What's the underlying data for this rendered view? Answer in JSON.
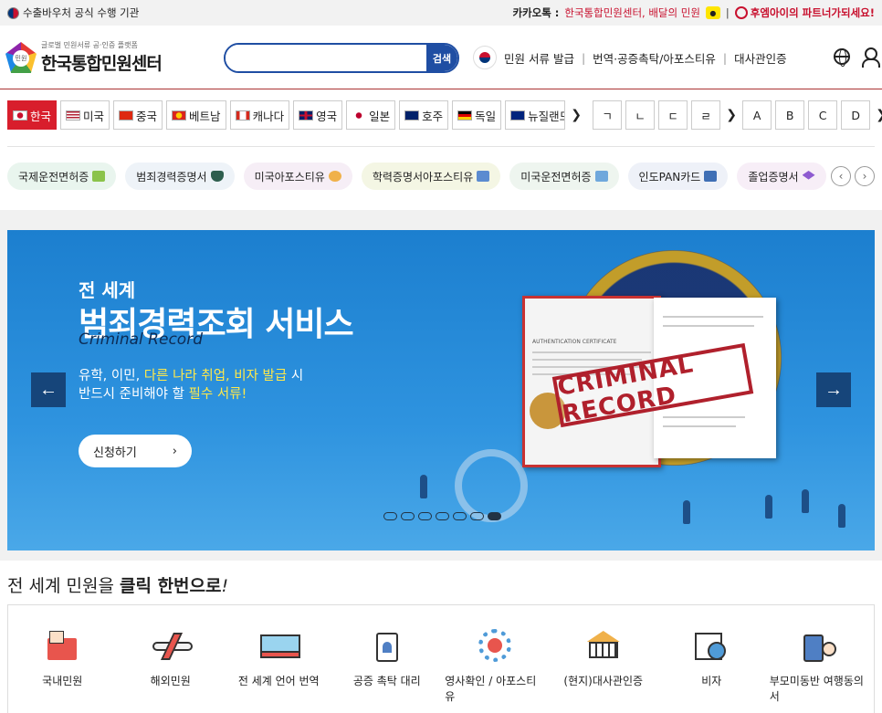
{
  "topbar": {
    "left_text": "수출바우처 공식 수행 기관",
    "kakao_label": "카카오톡 :",
    "kakao_text": "한국통합민원센터, 배달의 민원",
    "partner_text": "후엠아이의 파트너가되세요!"
  },
  "header": {
    "logo_sub": "글로벌 민원서류 공·인증 플랫폼",
    "logo_main": "한국통합민원센터",
    "logo_mark_text": "민원",
    "search_placeholder": "",
    "search_button": "검색",
    "nav": [
      "민원 서류 발급",
      "번역·공증촉탁/아포스티유",
      "대사관인증"
    ]
  },
  "countries": [
    {
      "label": "한국",
      "active": true
    },
    {
      "label": "미국",
      "active": false
    },
    {
      "label": "중국",
      "active": false
    },
    {
      "label": "베트남",
      "active": false
    },
    {
      "label": "캐나다",
      "active": false
    },
    {
      "label": "영국",
      "active": false
    },
    {
      "label": "일본",
      "active": false
    },
    {
      "label": "호주",
      "active": false
    },
    {
      "label": "독일",
      "active": false
    },
    {
      "label": "뉴질랜드",
      "active": false
    }
  ],
  "korean_letters": [
    "ㄱ",
    "ㄴ",
    "ㄷ",
    "ㄹ"
  ],
  "latin_letters": [
    "A",
    "B",
    "C",
    "D"
  ],
  "chips": [
    {
      "label": "국제운전면허증",
      "bg": "#e9f5ee"
    },
    {
      "label": "범죄경력증명서",
      "bg": "#eef3f8"
    },
    {
      "label": "미국아포스티유",
      "bg": "#f6eef6"
    },
    {
      "label": "학력증명서아포스티유",
      "bg": "#f4f6e4"
    },
    {
      "label": "미국운전면허증",
      "bg": "#eef5ef"
    },
    {
      "label": "인도PAN카드",
      "bg": "#eef1f8"
    },
    {
      "label": "졸업증명서",
      "bg": "#f7eef7"
    }
  ],
  "banner": {
    "subtitle": "전 세계",
    "title": "범죄경력조회 서비스",
    "english": "Criminal Record",
    "desc1_a": "유학, 이민, ",
    "desc1_b": "다른 나라 취업, 비자 발급",
    "desc1_c": " 시",
    "desc2_a": "반드시 준비해야 할 ",
    "desc2_b": "필수 서류!",
    "apply_label": "신청하기",
    "stamp_text": "CRIMINAL RECORD",
    "doc_heading": "AUTHENTICATION CERTIFICATE",
    "slide_count": 7,
    "active_slide": 6
  },
  "section": {
    "title_a": "전 세계 민원을 ",
    "title_b": "클릭 한번으로",
    "title_c": "!"
  },
  "quick_items": [
    {
      "label": "국내민원",
      "icon": "folder-icon"
    },
    {
      "label": "해외민원",
      "icon": "airplane-icon"
    },
    {
      "label": "전 세계 언어 번역",
      "icon": "ticket-icon"
    },
    {
      "label": "공증 촉탁 대리",
      "icon": "id-badge-icon"
    },
    {
      "label": "영사확인 / 아포스티유",
      "icon": "gear-person-icon"
    },
    {
      "label": "(현지)대사관인증",
      "icon": "embassy-icon"
    },
    {
      "label": "비자",
      "icon": "visa-globe-icon"
    },
    {
      "label": "부모미동반 여행동의서",
      "icon": "luggage-icon"
    }
  ],
  "colors": {
    "brand_red": "#d81e2c",
    "brand_blue": "#1f4ea3",
    "banner_blue": "#1c7fcf",
    "highlight_yellow": "#ffe94a"
  }
}
